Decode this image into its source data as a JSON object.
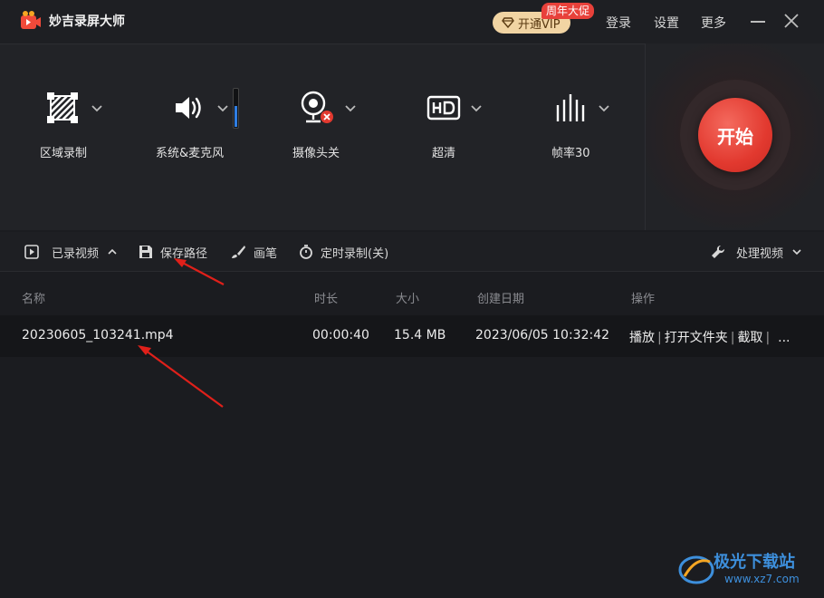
{
  "app": {
    "title": "妙吉录屏大师"
  },
  "header": {
    "vip_label": "开通VIP",
    "promo_badge": "周年大促",
    "login": "登录",
    "settings": "设置",
    "more": "更多"
  },
  "controls": {
    "region": "区域录制",
    "audio": "系统&麦克风",
    "camera": "摄像头关",
    "quality": "超清",
    "fps": "帧率30",
    "start": "开始"
  },
  "toolbar": {
    "recorded": "已录视频",
    "save_path": "保存路径",
    "brush": "画笔",
    "timer": "定时录制(关)",
    "process": "处理视频"
  },
  "table": {
    "headers": {
      "name": "名称",
      "duration": "时长",
      "size": "大小",
      "created": "创建日期",
      "actions": "操作"
    },
    "rows": [
      {
        "name": "20230605_103241.mp4",
        "duration": "00:00:40",
        "size": "15.4 MB",
        "created": "2023/06/05 10:32:42",
        "play": "播放",
        "open_folder": "打开文件夹",
        "capture": "截取",
        "more": "..."
      }
    ]
  },
  "watermark": {
    "name": "极光下载站",
    "url": "www.xz7.com"
  },
  "colors": {
    "accent_red": "#e2392f",
    "vip_gold": "#f1d4a3",
    "audio_level": "#2f7de1"
  },
  "audio_level": 0.55
}
